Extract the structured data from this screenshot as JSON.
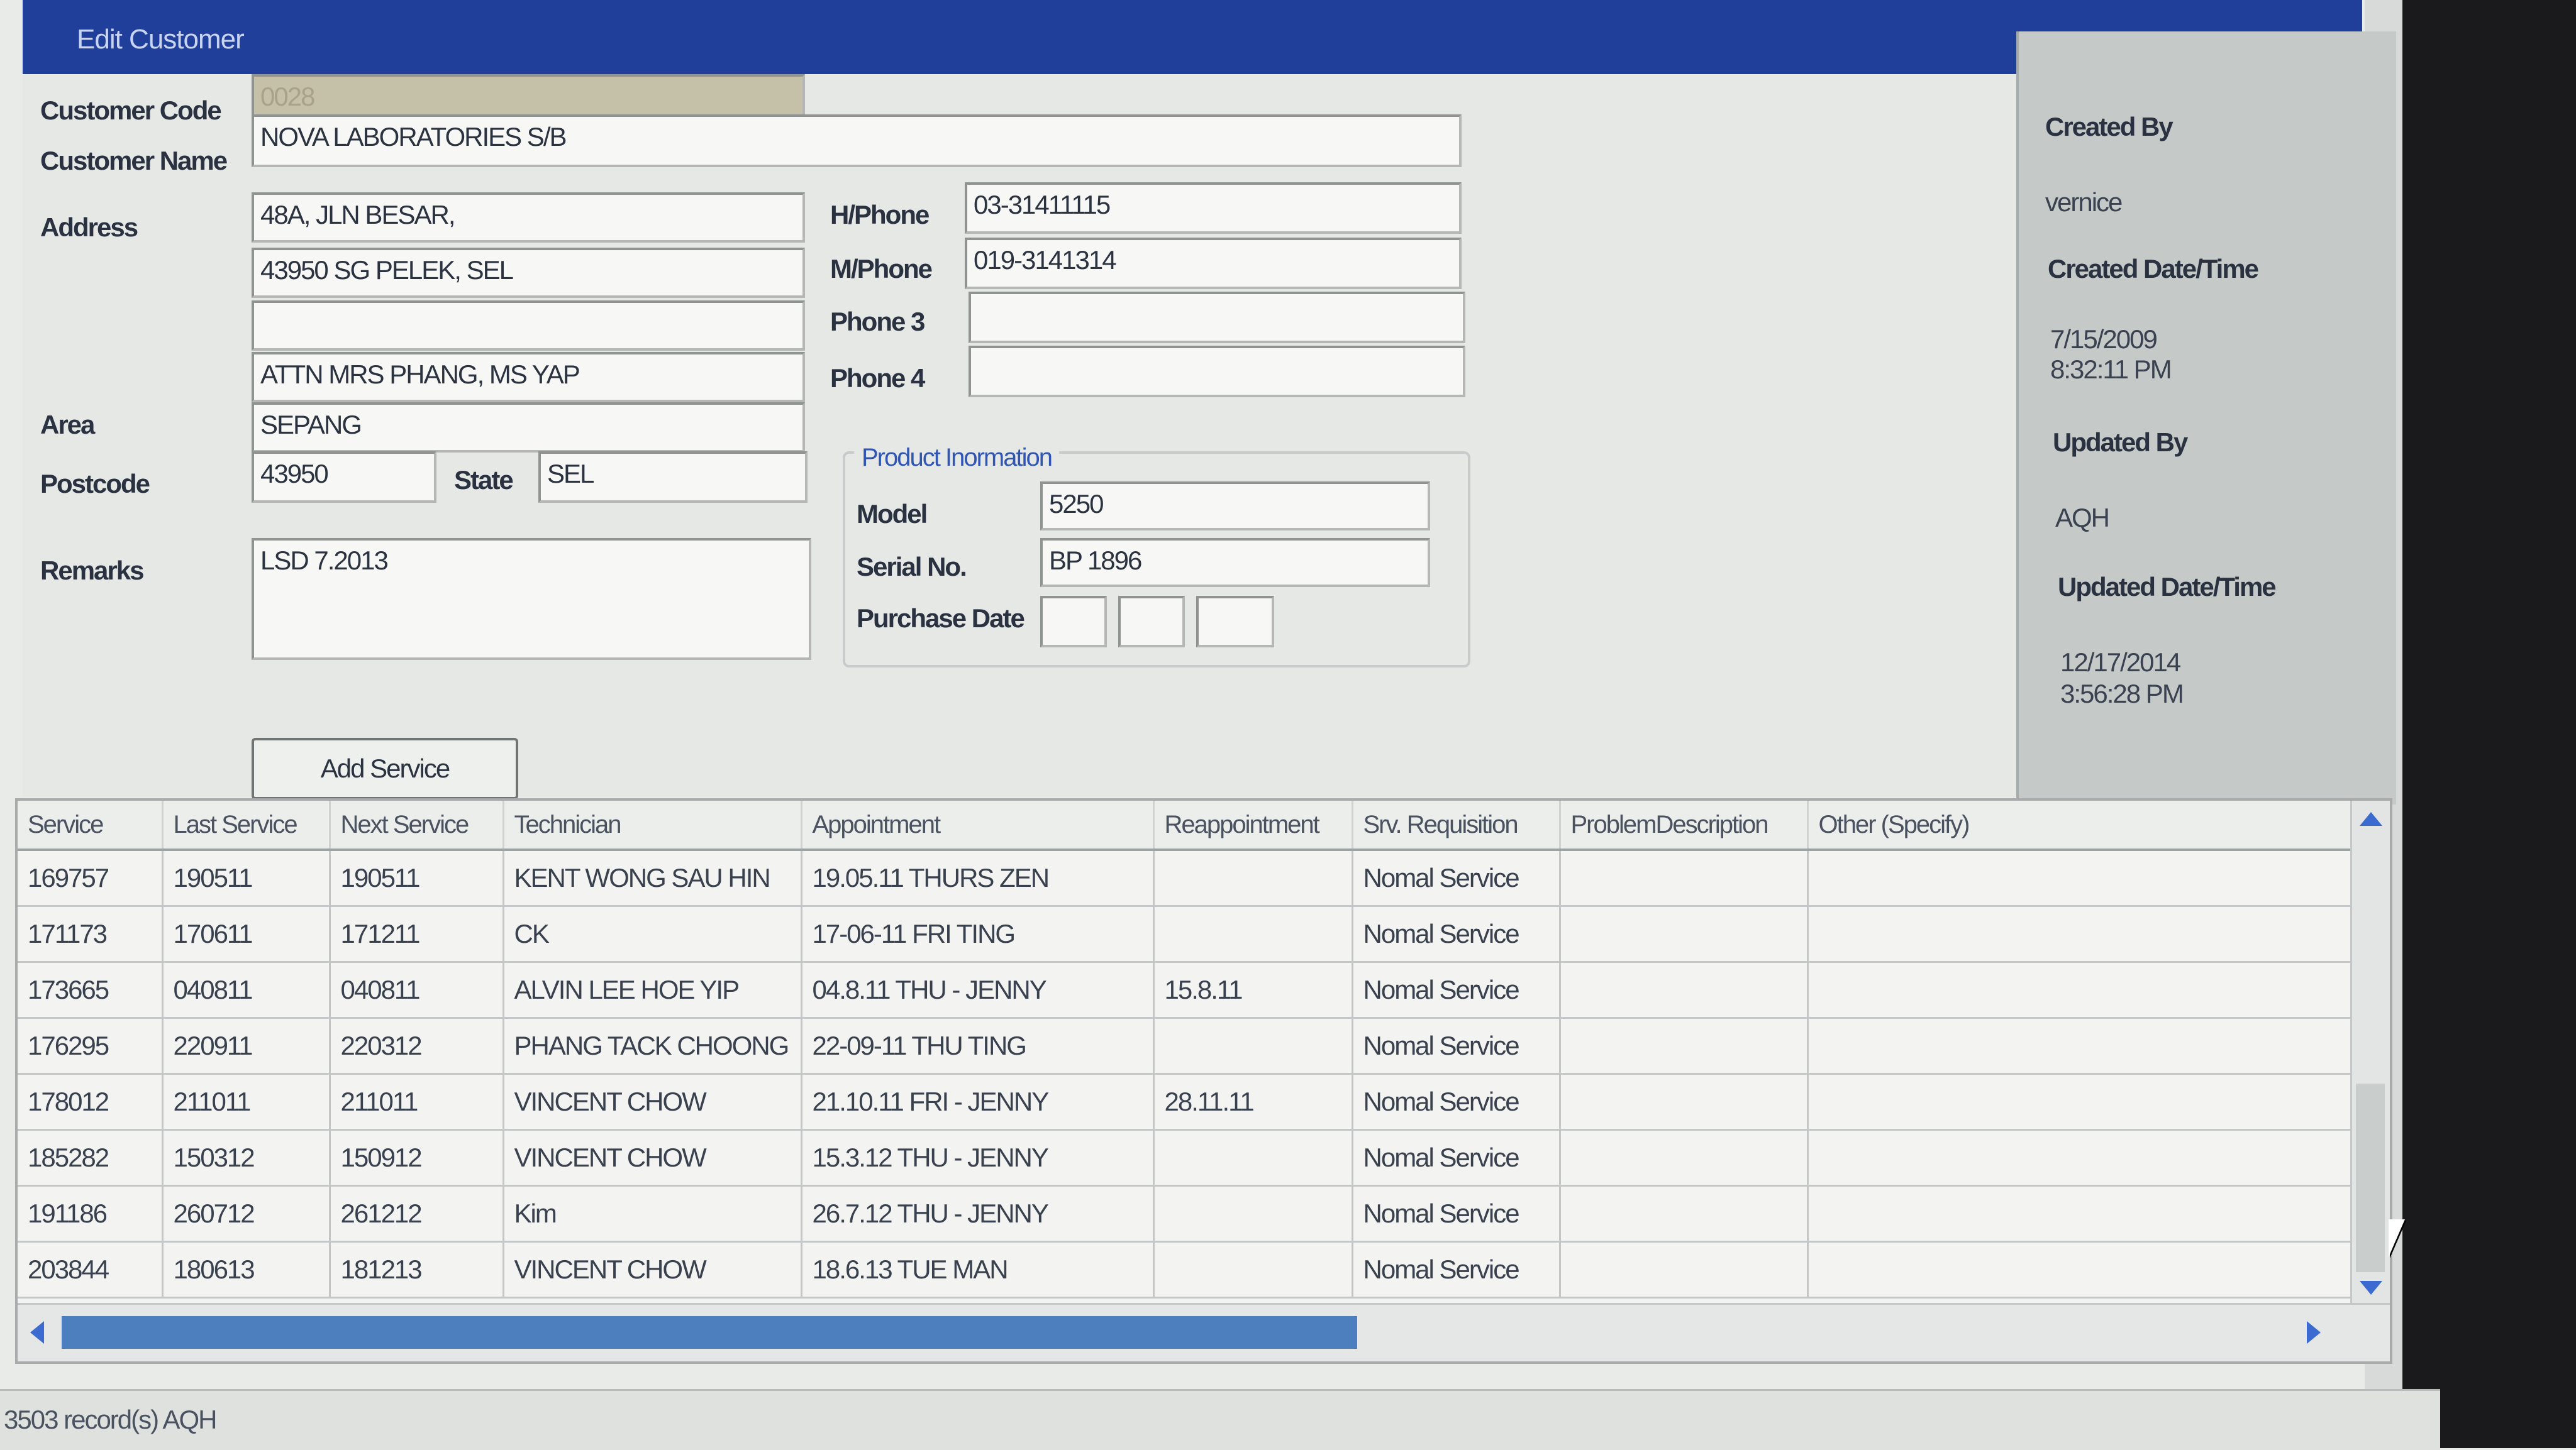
{
  "window": {
    "title": "Edit Customer"
  },
  "form": {
    "customer_code_label": "Customer Code",
    "customer_code_value": "0028",
    "customer_name_label": "Customer Name",
    "customer_name_value": "NOVA LABORATORIES S/B",
    "address_label": "Address",
    "address_lines": [
      "48A, JLN BESAR,",
      "43950 SG PELEK, SEL",
      "",
      "ATTN MRS PHANG, MS YAP"
    ],
    "hphone_label": "H/Phone",
    "hphone_value": "03-31411115",
    "mphone_label": "M/Phone",
    "mphone_value": "019-3141314",
    "phone3_label": "Phone 3",
    "phone3_value": "",
    "phone4_label": "Phone 4",
    "phone4_value": "",
    "area_label": "Area",
    "area_value": "SEPANG",
    "postcode_label": "Postcode",
    "postcode_value": "43950",
    "state_label": "State",
    "state_value": "SEL",
    "remarks_label": "Remarks",
    "remarks_value": "LSD 7.2013"
  },
  "product": {
    "group_title": "Product Inormation",
    "model_label": "Model",
    "model_value": "5250",
    "serial_label": "Serial No.",
    "serial_value": "BP 1896",
    "purchase_date_label": "Purchase Date",
    "purchase_date_parts": [
      "",
      "",
      ""
    ]
  },
  "buttons": {
    "add_service": "Add Service"
  },
  "audit": {
    "created_by_label": "Created By",
    "created_by_value": "vernice",
    "created_dt_label": "Created Date/Time",
    "created_dt_date": "7/15/2009",
    "created_dt_time": "8:32:11 PM",
    "updated_by_label": "Updated By",
    "updated_by_value": "AQH",
    "updated_dt_label": "Updated Date/Time",
    "updated_dt_date": "12/17/2014",
    "updated_dt_time": "3:56:28 PM"
  },
  "grid": {
    "columns": [
      "Service",
      "Last Service",
      "Next Service",
      "Technician",
      "Appointment",
      "Reappointment",
      "Srv. Requisition",
      "ProblemDescription",
      "Other (Specify)"
    ],
    "rows": [
      [
        "169757",
        "190511",
        "190511",
        "KENT WONG SAU HIN",
        "19.05.11 THURS ZEN",
        "",
        "Nomal Service",
        "",
        ""
      ],
      [
        "171173",
        "170611",
        "171211",
        "CK",
        "17-06-11 FRI TING",
        "",
        "Nomal Service",
        "",
        ""
      ],
      [
        "173665",
        "040811",
        "040811",
        "ALVIN LEE HOE YIP",
        "04.8.11 THU - JENNY",
        "15.8.11",
        "Nomal Service",
        "",
        ""
      ],
      [
        "176295",
        "220911",
        "220312",
        "PHANG TACK CHOONG",
        "22-09-11 THU TING",
        "",
        "Nomal Service",
        "",
        ""
      ],
      [
        "178012",
        "211011",
        "211011",
        "VINCENT CHOW",
        "21.10.11 FRI - JENNY",
        "28.11.11",
        "Nomal Service",
        "",
        ""
      ],
      [
        "185282",
        "150312",
        "150912",
        "VINCENT CHOW",
        "15.3.12 THU - JENNY",
        "",
        "Nomal Service",
        "",
        ""
      ],
      [
        "191186",
        "260712",
        "261212",
        "Kim",
        "26.7.12 THU - JENNY",
        "",
        "Nomal Service",
        "",
        ""
      ],
      [
        "203844",
        "180613",
        "181213",
        "VINCENT CHOW",
        "18.6.13 TUE MAN",
        "",
        "Nomal Service",
        "",
        ""
      ]
    ]
  },
  "status": {
    "text": "3503 record(s)  AQH"
  }
}
